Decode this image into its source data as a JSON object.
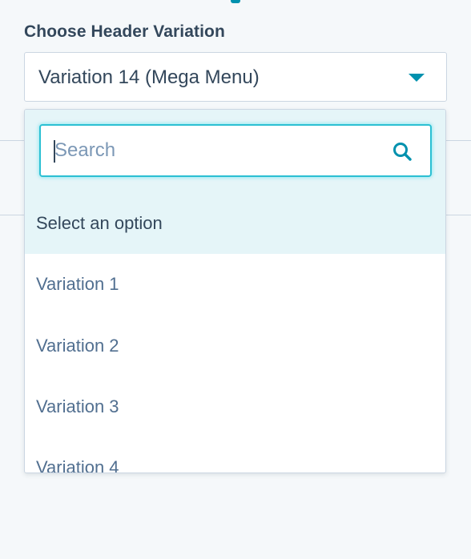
{
  "field": {
    "label": "Choose Header Variation",
    "selected_value": "Variation 14 (Mega Menu)"
  },
  "dropdown": {
    "search": {
      "placeholder": "Search",
      "value": ""
    },
    "options": [
      {
        "label": "Select an option",
        "highlighted": true
      },
      {
        "label": "Variation 1"
      },
      {
        "label": "Variation 2"
      },
      {
        "label": "Variation 3"
      },
      {
        "label": "Variation 4"
      }
    ]
  },
  "icons": {
    "caret": "chevron-down-icon",
    "search": "search-icon"
  },
  "colors": {
    "accent": "#0091ae",
    "focus_border": "#2cc0d3",
    "highlight_bg": "#e5f5f8",
    "text_primary": "#33475b",
    "text_secondary": "#516f90"
  }
}
